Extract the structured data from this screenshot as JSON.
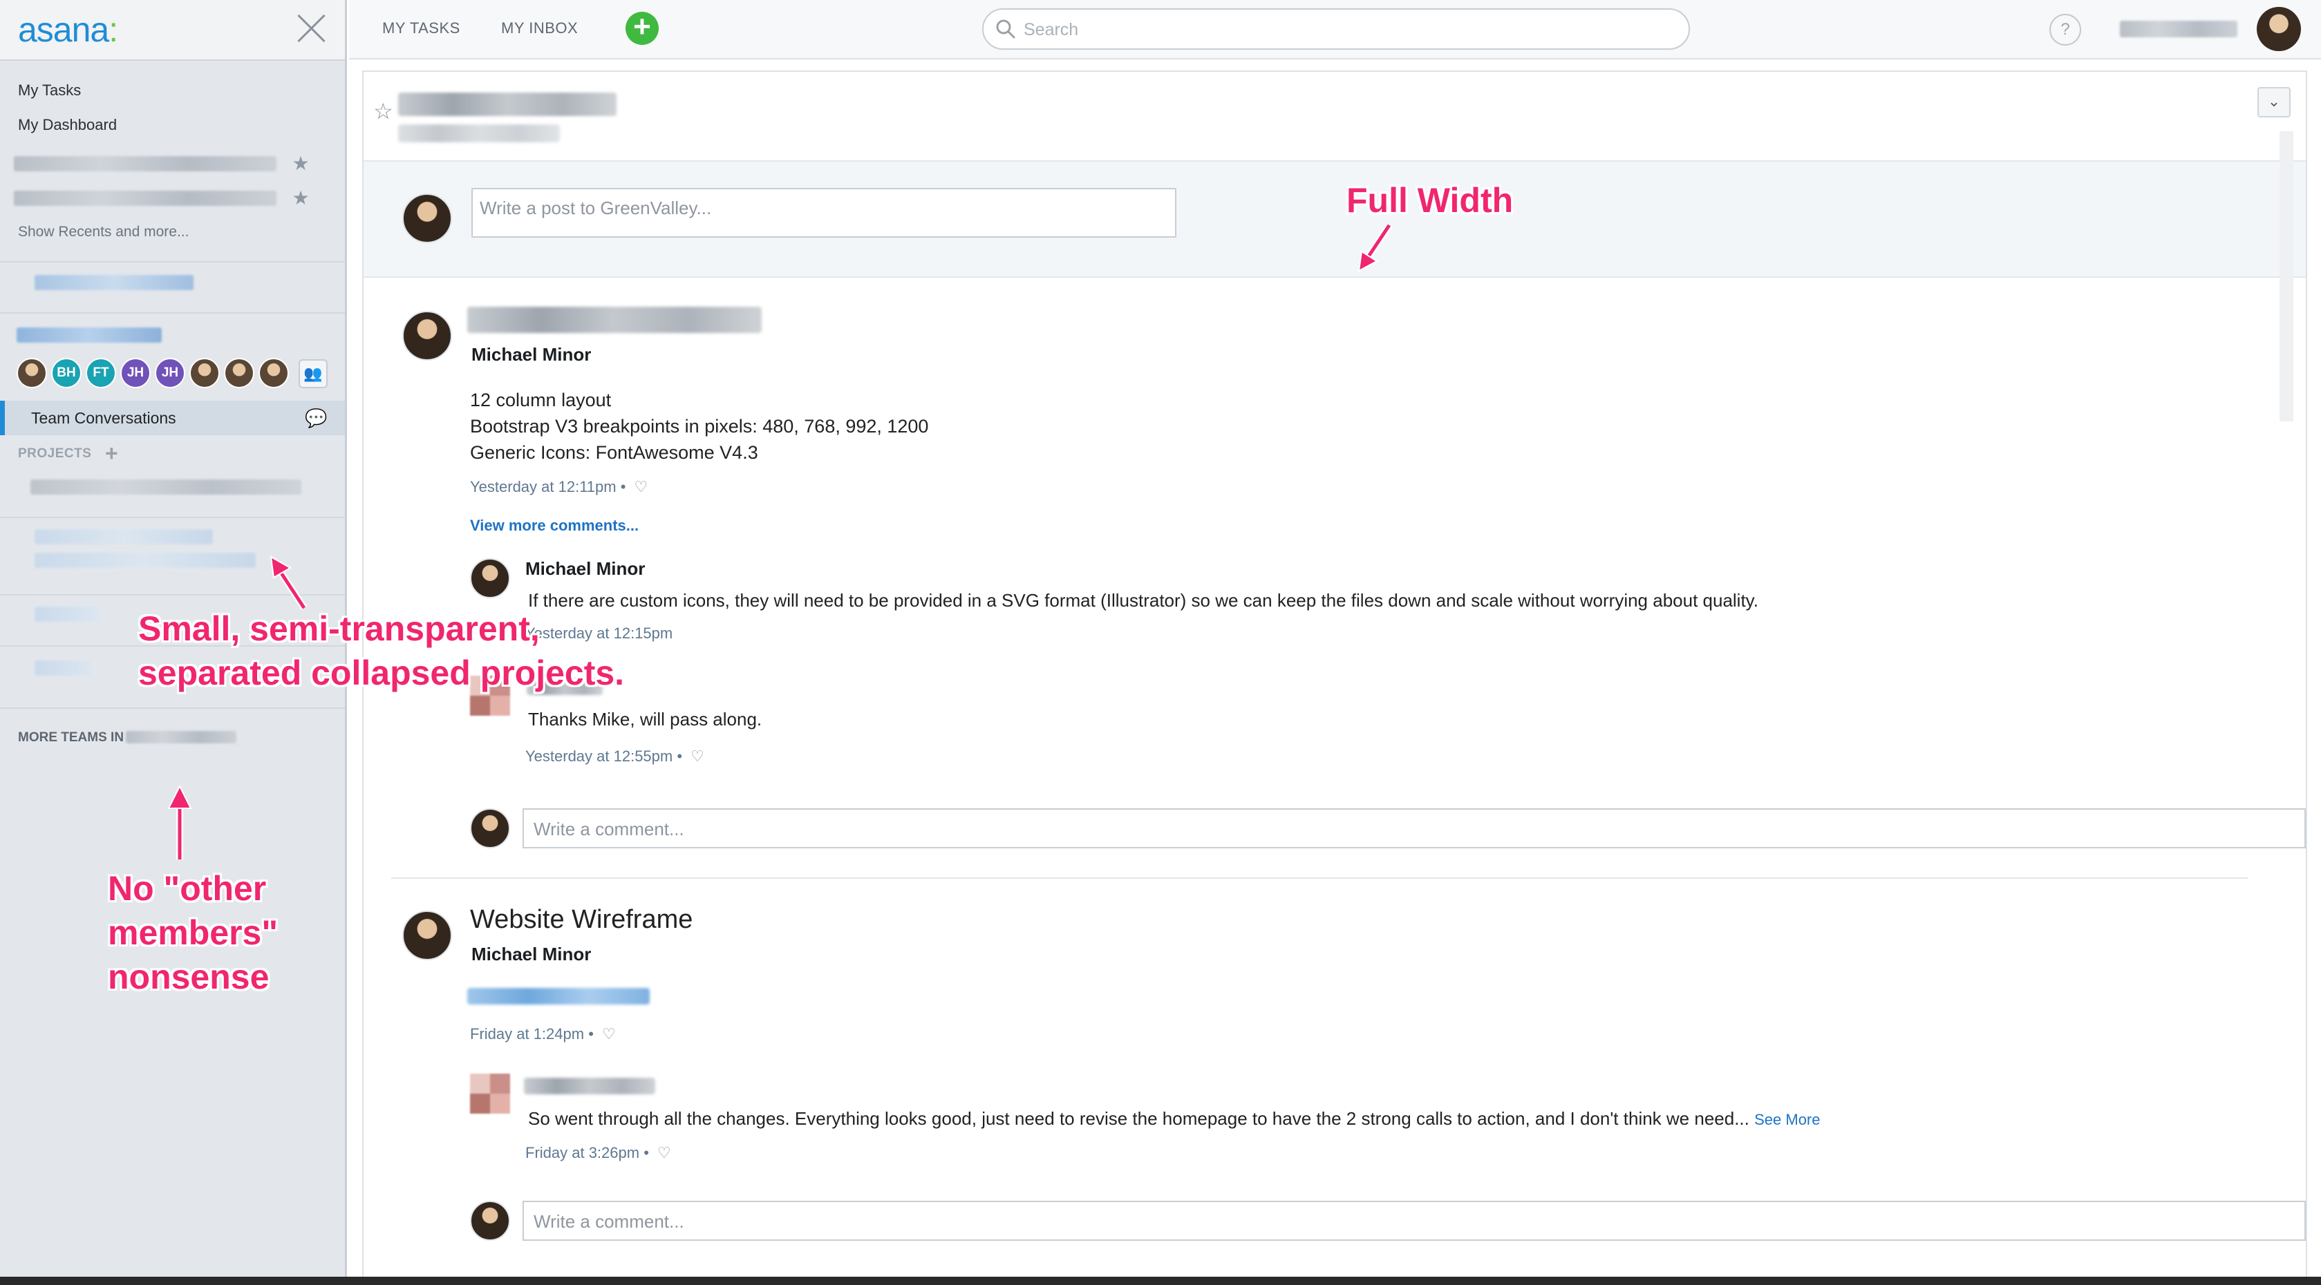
{
  "sidebar": {
    "logo": "asana",
    "logo_dots": ":",
    "nav": [
      "My Tasks",
      "My Dashboard"
    ],
    "show_recents": "Show Recents and more...",
    "team_members": [
      {
        "initials": "",
        "color": "#8a6b52",
        "photo": true
      },
      {
        "initials": "BH",
        "color": "#1aa3b3"
      },
      {
        "initials": "FT",
        "color": "#1aa3b3"
      },
      {
        "initials": "JH",
        "color": "#7052b8"
      },
      {
        "initials": "JH",
        "color": "#7052b8"
      },
      {
        "initials": "",
        "color": "#5a4634",
        "photo": true
      },
      {
        "initials": "",
        "color": "#b06a3a",
        "photo": true
      },
      {
        "initials": "",
        "color": "#4a4a4a",
        "photo": true
      }
    ],
    "team_conversations": "Team Conversations",
    "projects_header": "PROJECTS",
    "more_teams": "MORE TEAMS IN"
  },
  "topbar": {
    "my_tasks": "MY TASKS",
    "my_inbox": "MY INBOX",
    "add": "+",
    "search_placeholder": "Search",
    "help": "?"
  },
  "main": {
    "composer_placeholder": "Write a post to GreenValley...",
    "posts": [
      {
        "author": "Michael Minor",
        "body": [
          "12 column layout",
          "Bootstrap V3 breakpoints in pixels: 480, 768, 992, 1200",
          "Generic Icons: FontAwesome V4.3"
        ],
        "timestamp": "Yesterday at 12:11pm",
        "view_more": "View more comments...",
        "comments": [
          {
            "author": "Michael Minor",
            "text": "If there are custom icons, they will need to be provided in a SVG format (Illustrator) so we can keep the files down and scale without worrying about quality.",
            "timestamp": "Yesterday at 12:15pm"
          },
          {
            "author": "",
            "text": "Thanks Mike, will pass along.",
            "timestamp": "Yesterday at 12:55pm"
          }
        ],
        "comment_placeholder": "Write a comment..."
      },
      {
        "title": "Website Wireframe",
        "author": "Michael Minor",
        "timestamp": "Friday at 1:24pm",
        "comments": [
          {
            "author": "",
            "text": "So went through all the changes. Everything looks good, just need to revise the homepage to have the 2 strong calls to action, and I don't think we need...",
            "see_more": "See More",
            "timestamp": "Friday at 3:26pm"
          }
        ],
        "comment_placeholder": "Write a comment..."
      }
    ]
  },
  "annotations": {
    "full_width": "Full Width",
    "collapsed_line1": "Small, semi-transparent,",
    "collapsed_line2": "separated collapsed projects.",
    "no_other_line1": "No \"other",
    "no_other_line2": "members\"",
    "no_other_line3": "nonsense"
  },
  "colors": {
    "accent": "#1f8dd6",
    "annotation": "#f0266e",
    "add_button": "#3fb93f",
    "link": "#1f72c4"
  }
}
